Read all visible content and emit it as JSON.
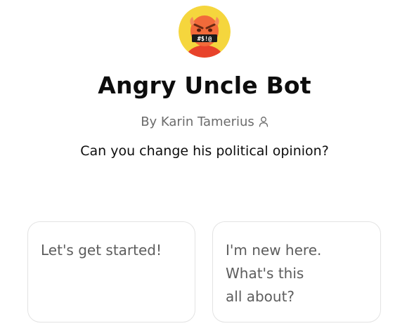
{
  "bot": {
    "name": "Angry Uncle Bot",
    "author": "By Karin Tamerius",
    "description": "Can you change his political opinion?",
    "avatar_censor_text": "#$!@",
    "avatar_icon": "angry-face-icon"
  },
  "starters": [
    {
      "label": "Let's get started!"
    },
    {
      "label": "I'm new here.\nWhat's this\nall about?"
    }
  ],
  "colors": {
    "avatar_bg": "#f5d63d",
    "face": "#f26a3a",
    "text_primary": "#0d0d0d",
    "text_secondary": "#6b6b6b",
    "card_border": "#e3e3e3"
  }
}
